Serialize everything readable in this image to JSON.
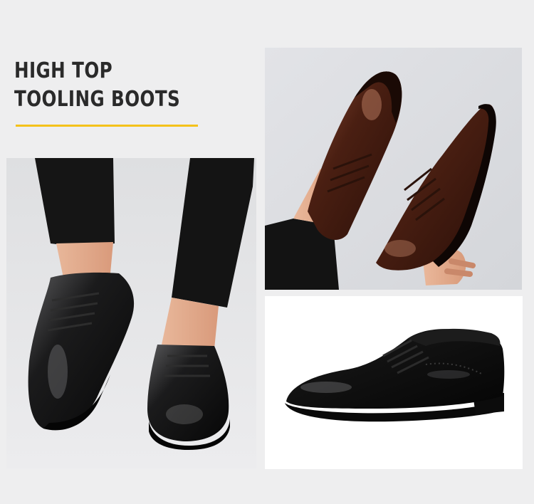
{
  "headline": {
    "line1": "HIGH TOP",
    "line2": "TOOLING BOOTS"
  },
  "colors": {
    "accent": "#f4c21a",
    "headline_text": "#2a2a2a",
    "page_background": "#eeeeef",
    "shoe_black": "#111111",
    "shoe_brown": "#4a1f12"
  },
  "photos": [
    {
      "subject": "legs in black trousers wearing black lace-up derby shoes"
    },
    {
      "subject": "brown leather derby shoe worn on foot and shoe held in hand"
    },
    {
      "subject": "black leather derby shoe side view on white background"
    }
  ]
}
